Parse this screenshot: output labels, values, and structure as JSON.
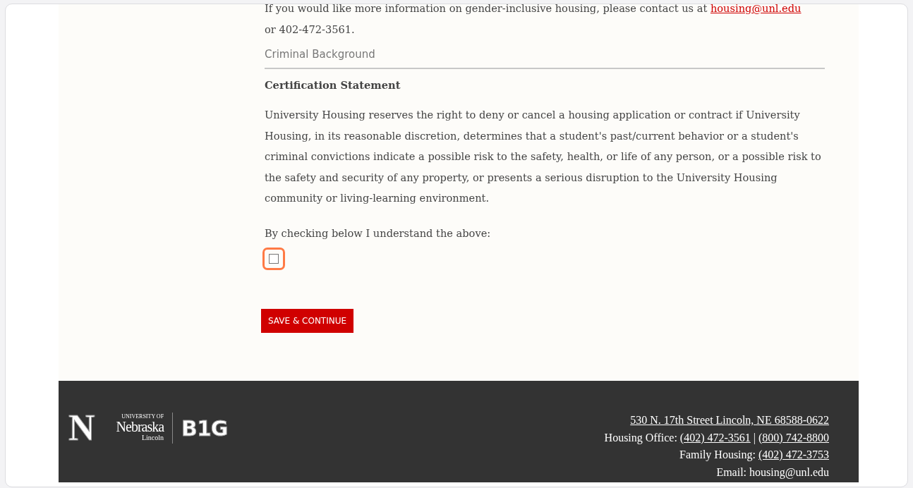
{
  "intro": {
    "text_before": "If you would like more information on gender-inclusive housing, please contact us at",
    "email_link": "housing@unl.edu",
    "text_after": "or 402-472-3561."
  },
  "section_title": "Criminal Background",
  "certification": {
    "heading": "Certification Statement",
    "body": "University Housing reserves the right to deny or cancel a housing application or contract if University Housing, in its reasonable discretion, determines that a student's past/current behavior or a student's criminal convictions indicate a possible risk to the safety, health, or life of any person, or a possible risk to the safety and security of any property, or presents a serious disruption to the University Housing community or living-learning environment.",
    "prompt": "By checking below I understand the above:",
    "checked": false
  },
  "save_button": "SAVE & CONTINUE",
  "footer": {
    "logo_letter": "N",
    "logo_university": "UNIVERSITY OF",
    "logo_name": "Nebraska",
    "logo_city": "Lincoln",
    "logo_conference": "B1G",
    "lines": [
      {
        "links": [
          "530 N. 17th Street Lincoln, NE 68588-0622"
        ]
      },
      {
        "label": "Housing Office:",
        "links": [
          "(402) 472-3561",
          "(800) 742-8800"
        ],
        "separator": "|"
      },
      {
        "label": "Family Housing:",
        "links": [
          "(402) 472-3753"
        ]
      },
      {
        "label": "Email: housing@unl.edu"
      }
    ]
  }
}
